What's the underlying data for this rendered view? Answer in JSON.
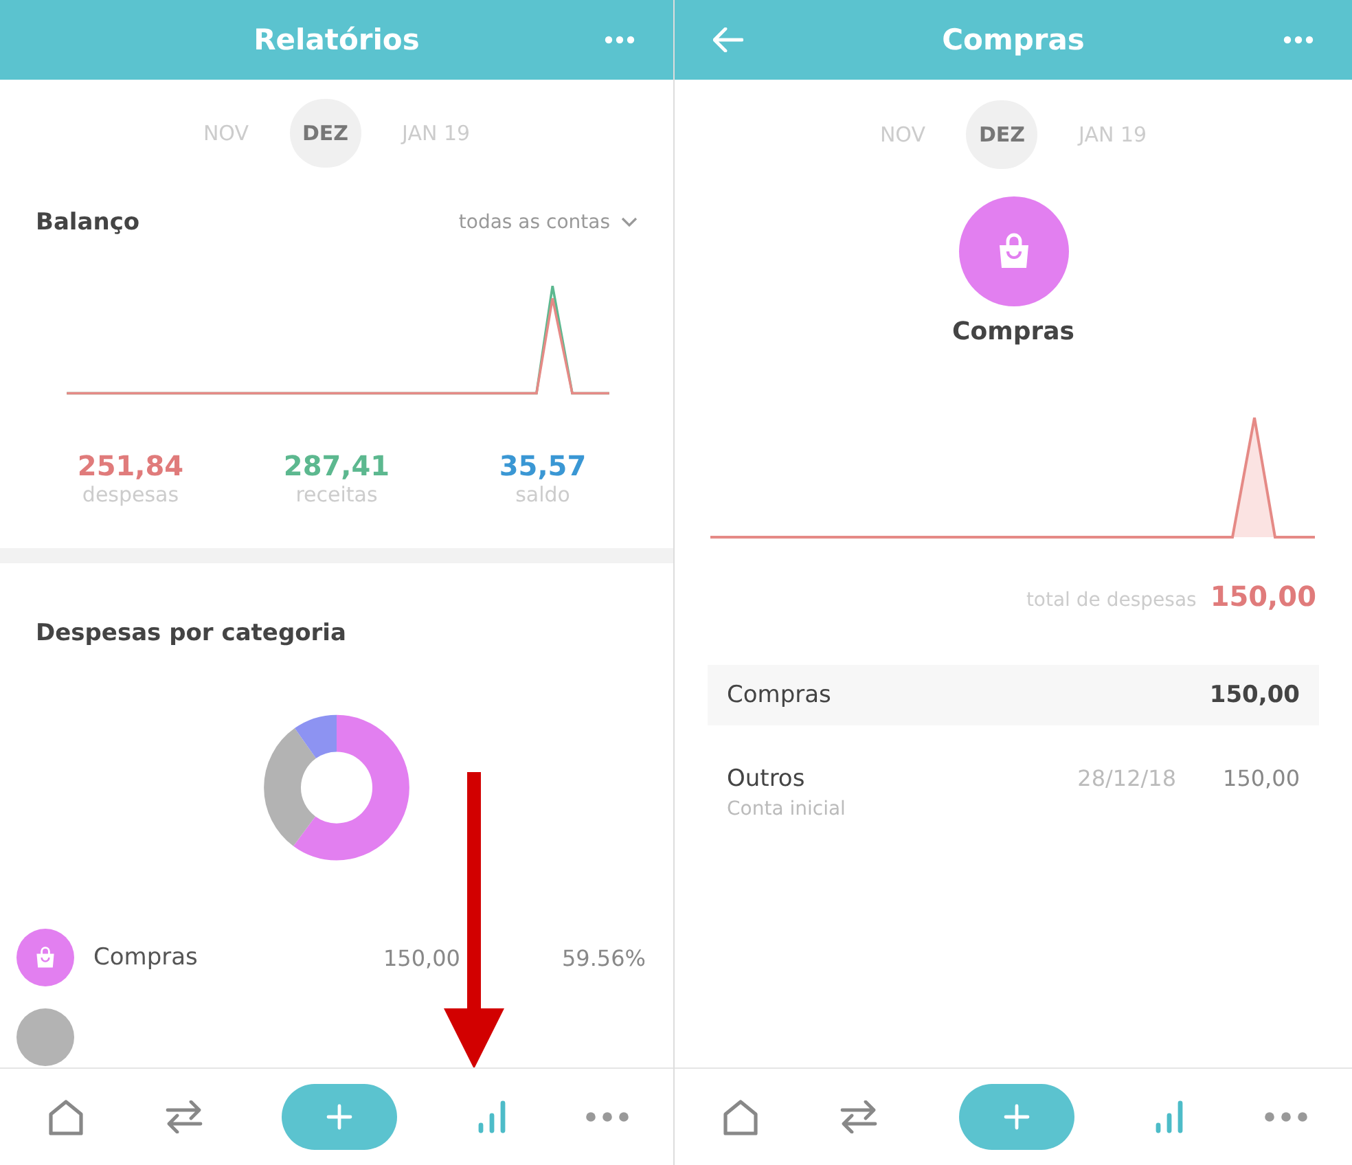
{
  "screens": [
    {
      "header": {
        "title": "Relatórios",
        "back": false
      },
      "months": [
        {
          "label": "NOV",
          "selected": false
        },
        {
          "label": "DEZ",
          "selected": true
        },
        {
          "label": "JAN 19",
          "selected": false
        }
      ],
      "balance": {
        "title": "Balanço",
        "filter": "todas as contas",
        "stats": [
          {
            "value": "251,84",
            "label": "despesas",
            "color": "#e07b7b"
          },
          {
            "value": "287,41",
            "label": "receitas",
            "color": "#5cb88f"
          },
          {
            "value": "35,57",
            "label": "saldo",
            "color": "#3a97d4"
          }
        ]
      },
      "categories": {
        "title": "Despesas por categoria",
        "legend": [
          {
            "name": "Compras",
            "amount": "150,00",
            "percent": "59.56%",
            "color": "#e27ff0"
          },
          {
            "color": "#b3b3b3"
          }
        ]
      },
      "nav": [
        {
          "kind": "home",
          "selected": false
        },
        {
          "kind": "transfer",
          "selected": false
        },
        {
          "kind": "add",
          "selected": false
        },
        {
          "kind": "reports",
          "selected": true
        },
        {
          "kind": "more",
          "selected": false
        }
      ]
    },
    {
      "header": {
        "title": "Compras",
        "back": true
      },
      "months": [
        {
          "label": "NOV",
          "selected": false
        },
        {
          "label": "DEZ",
          "selected": true
        },
        {
          "label": "JAN 19",
          "selected": false
        }
      ],
      "category": {
        "name": "Compras",
        "color": "#e27ff0"
      },
      "total": {
        "label": "total de despesas",
        "value": "150,00"
      },
      "rows": [
        {
          "kind": "group",
          "name": "Compras",
          "amount": "150,00"
        },
        {
          "kind": "item",
          "name": "Outros",
          "account": "Conta inicial",
          "date": "28/12/18",
          "amount": "150,00"
        }
      ],
      "nav": [
        {
          "kind": "home",
          "selected": false
        },
        {
          "kind": "transfer",
          "selected": false
        },
        {
          "kind": "add",
          "selected": false
        },
        {
          "kind": "reports",
          "selected": true
        },
        {
          "kind": "more",
          "selected": false
        }
      ]
    }
  ]
}
